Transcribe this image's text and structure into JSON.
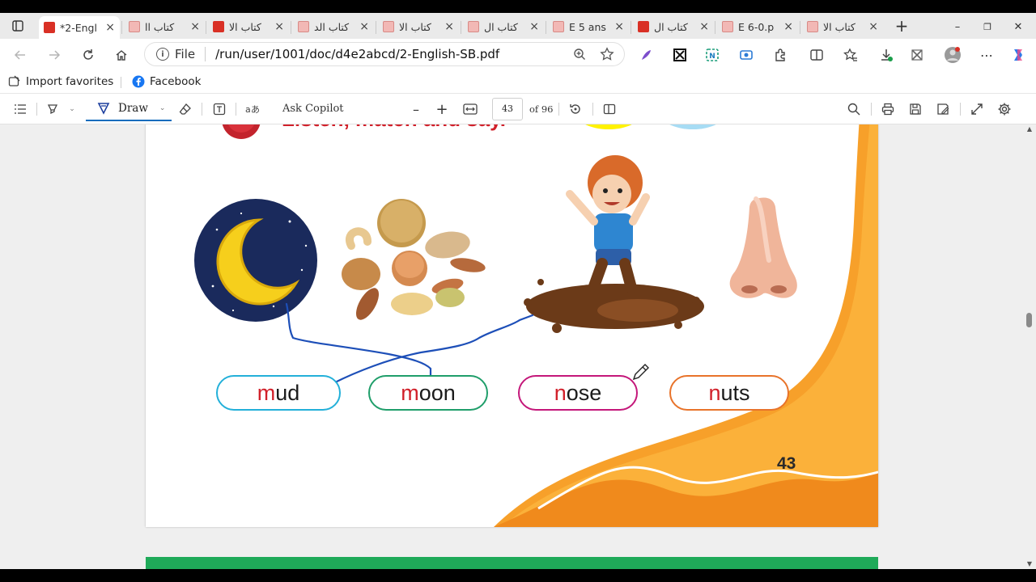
{
  "tabs": [
    {
      "title": "*2-Engl",
      "favicon": "pdf-red",
      "active": true
    },
    {
      "title": "كتاب اا",
      "favicon": "pdf-pink"
    },
    {
      "title": "كتاب الا",
      "favicon": "pdf-red"
    },
    {
      "title": "كتاب الد",
      "favicon": "pdf-pink"
    },
    {
      "title": "كتاب الا",
      "favicon": "pdf-pink"
    },
    {
      "title": "كتاب ال",
      "favicon": "pdf-pink"
    },
    {
      "title": "E 5 ans",
      "favicon": "pdf-pink"
    },
    {
      "title": "كتاب ال",
      "favicon": "pdf-red"
    },
    {
      "title": "E 6-0.p",
      "favicon": "pdf-pink"
    },
    {
      "title": "كتاب الا",
      "favicon": "pdf-pink"
    }
  ],
  "tab_close": "×",
  "new_tab": "+",
  "window_controls": {
    "minimize": "–",
    "restore": "❐",
    "close": "✕"
  },
  "address": {
    "scheme": "File",
    "url": "/run/user/1001/doc/d4e2abcd/2-English-SB.pdf"
  },
  "favorites": [
    {
      "label": "Import favorites",
      "icon": "import-icon"
    },
    {
      "label": "Facebook",
      "icon": "facebook-icon"
    }
  ],
  "pdf_toolbar": {
    "draw_label": "Draw",
    "ask_copilot": "Ask Copilot",
    "page_number": "43",
    "page_count": "of 96",
    "zoom_out": "–",
    "zoom_in": "+"
  },
  "page": {
    "heading": "Listen, match and say.",
    "page_number": "43",
    "words": [
      {
        "first": "m",
        "rest": "ud",
        "border": "#23b0d9"
      },
      {
        "first": "m",
        "rest": "oon",
        "border": "#1f9e6a"
      },
      {
        "first": "n",
        "rest": "ose",
        "border": "#c4177a"
      },
      {
        "first": "n",
        "rest": "uts",
        "border": "#e8732a"
      }
    ]
  },
  "colors": {
    "accent": "#0f6cbd",
    "heading": "#d1202a",
    "orange": "#f7a02a",
    "green": "#1faa59",
    "ink_line": "#1d4fb8"
  }
}
